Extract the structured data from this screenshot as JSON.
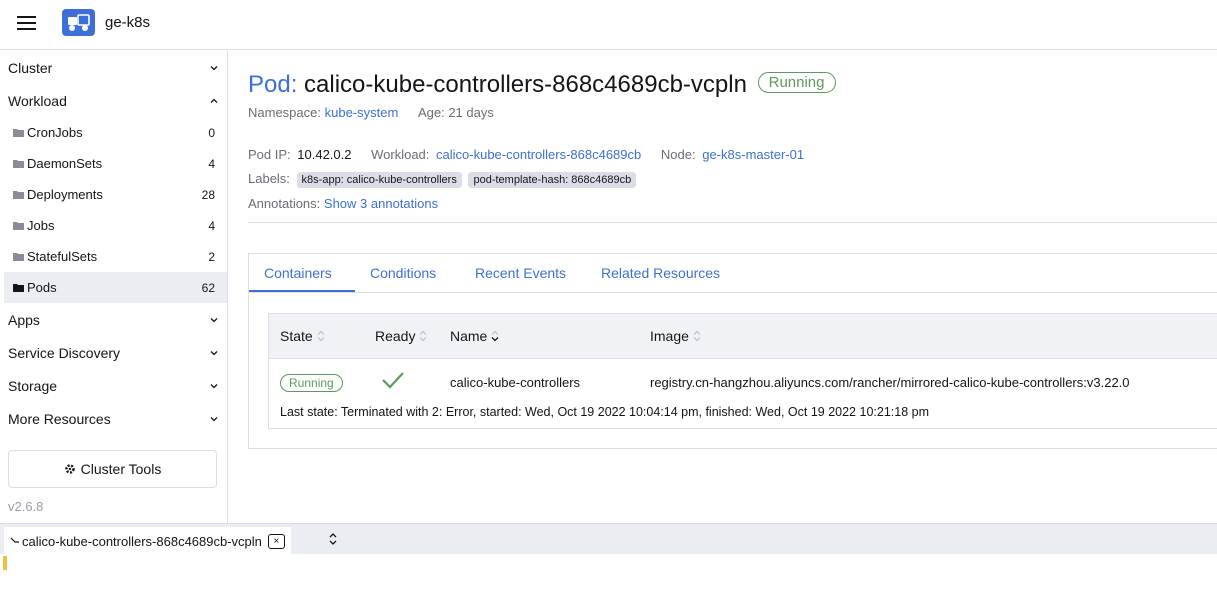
{
  "header": {
    "cluster_name": "ge-k8s"
  },
  "sidebar": {
    "groups": {
      "cluster": "Cluster",
      "workload": "Workload",
      "apps": "Apps",
      "service_discovery": "Service Discovery",
      "storage": "Storage",
      "more_resources": "More Resources"
    },
    "items": [
      {
        "label": "CronJobs",
        "count": "0"
      },
      {
        "label": "DaemonSets",
        "count": "4"
      },
      {
        "label": "Deployments",
        "count": "28"
      },
      {
        "label": "Jobs",
        "count": "4"
      },
      {
        "label": "StatefulSets",
        "count": "2"
      },
      {
        "label": "Pods",
        "count": "62"
      }
    ],
    "cluster_tools": "Cluster Tools",
    "version": "v2.6.8"
  },
  "pod": {
    "kind": "Pod:",
    "name": "calico-kube-controllers-868c4689cb-vcpln",
    "status": "Running",
    "namespace_label": "Namespace:",
    "namespace": "kube-system",
    "age_label": "Age:",
    "age": "21 days",
    "ip_label": "Pod IP:",
    "ip": "10.42.0.2",
    "workload_label": "Workload:",
    "workload": "calico-kube-controllers-868c4689cb",
    "node_label": "Node:",
    "node": "ge-k8s-master-01",
    "labels_label": "Labels:",
    "labels": [
      "k8s-app: calico-kube-controllers",
      "pod-template-hash: 868c4689cb"
    ],
    "annotations_label": "Annotations:",
    "annotations_link": "Show 3 annotations"
  },
  "tabs": [
    "Containers",
    "Conditions",
    "Recent Events",
    "Related Resources"
  ],
  "table": {
    "headers": [
      "State",
      "Ready",
      "Name",
      "Image"
    ],
    "row": {
      "state": "Running",
      "name": "calico-kube-controllers",
      "image": "registry.cn-hangzhou.aliyuncs.com/rancher/mirrored-calico-kube-controllers:v3.22.0",
      "last_state": "Last state: Terminated with 2: Error, started: Wed, Oct 19 2022 10:04:14 pm, finished: Wed, Oct 19 2022 10:21:18 pm"
    }
  },
  "terminal": {
    "tab_label": "calico-kube-controllers-868c4689cb-vcpln",
    "close_symbol": "×"
  },
  "colors": {
    "accent": "#3d70d6",
    "success": "#5d995d",
    "active_bg": "#eaedf2"
  }
}
